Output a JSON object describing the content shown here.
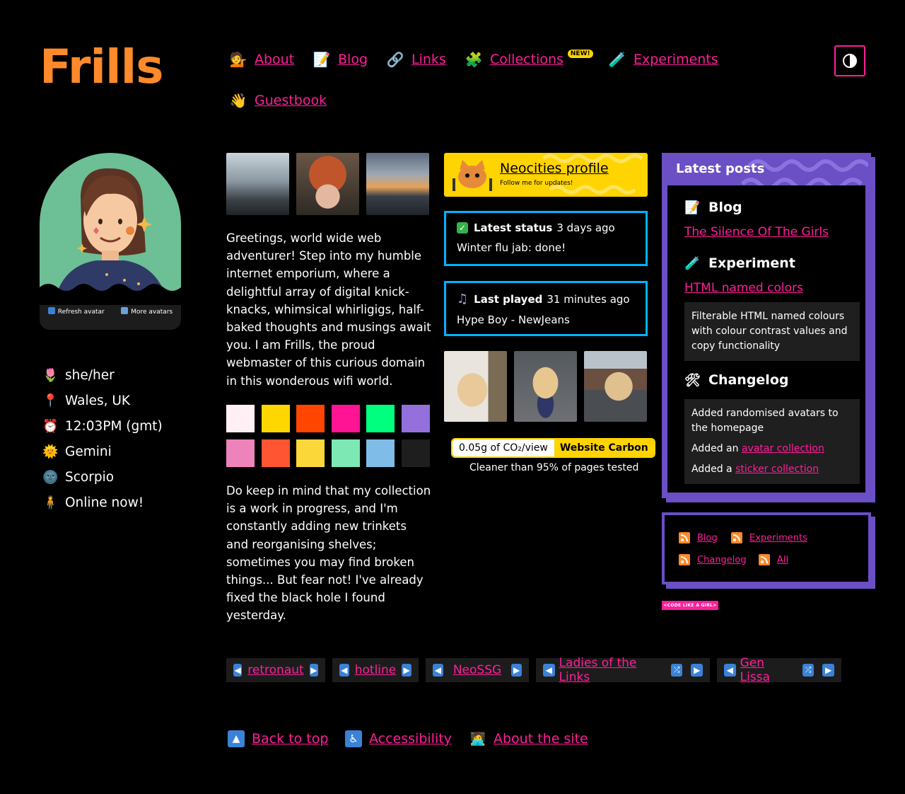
{
  "site": {
    "title": "Frills"
  },
  "nav": [
    {
      "label": "About",
      "icon": "person-tipping-hand-icon"
    },
    {
      "label": "Blog",
      "icon": "memo-icon"
    },
    {
      "label": "Links",
      "icon": "link-icon"
    },
    {
      "label": "Collections",
      "icon": "puzzle-icon",
      "badge": "NEW!"
    },
    {
      "label": "Experiments",
      "icon": "test-tube-icon"
    },
    {
      "label": "Guestbook",
      "icon": "waving-hand-icon"
    }
  ],
  "avatar": {
    "refresh_label": "Refresh avatar",
    "more_label": "More avatars"
  },
  "profile": [
    {
      "icon": "tulip-icon",
      "text": "she/her"
    },
    {
      "icon": "pin-icon",
      "text": "Wales, UK"
    },
    {
      "icon": "alarm-clock-icon",
      "text": "12:03PM (gmt)"
    },
    {
      "icon": "gemini-sun-icon",
      "text": "Gemini"
    },
    {
      "icon": "scorpio-moon-icon",
      "text": "Scorpio"
    },
    {
      "icon": "person-standing-icon",
      "text": "Online now!"
    }
  ],
  "intro": "Greetings, world wide web adventurer! Step into my humble internet emporium, where a delightful array of digital knick-knacks, whimsical whirligigs, half-baked thoughts and musings await you. I am Frills, the proud webmaster of this curious domain in this wonderous wifi world.",
  "swatches": [
    "#fff0f5",
    "#ffd700",
    "#ff4500",
    "#ff1493",
    "#00ff7f",
    "#9370db",
    "#ee82ba",
    "#ff5533",
    "#fcd73a",
    "#7ee8b5",
    "#7fbde8",
    "#1e1e1e"
  ],
  "intro2": "Do keep in mind that my collection is a work in progress, and I'm constantly adding new trinkets and reorganising shelves; sometimes you may find broken things... But fear not! I've already fixed the black hole I found yesterday.",
  "neocities": {
    "title": "Neocities profile",
    "subtitle": "Follow me for updates!"
  },
  "status": {
    "label": "Latest status",
    "time": "3 days ago",
    "text": "Winter flu jab: done!"
  },
  "played": {
    "label": "Last played",
    "time": "31 minutes ago",
    "text": "Hype Boy - NewJeans"
  },
  "carbon": {
    "value": "0.05g of CO₂/view",
    "brand": "Website Carbon",
    "caption": "Cleaner than 95% of pages tested"
  },
  "posts": {
    "title": "Latest posts",
    "blog": {
      "heading": "Blog",
      "link": "The Silence Of The Girls"
    },
    "experiment": {
      "heading": "Experiment",
      "link": "HTML named colors",
      "desc": "Filterable HTML named colours with colour contrast values and copy functionality"
    },
    "changelog": {
      "heading": "Changelog",
      "item1": "Added randomised avatars to the homepage",
      "item2_prefix": "Added an",
      "item2_link": "avatar collection",
      "item3_prefix": "Added a",
      "item3_link": "sticker collection"
    }
  },
  "feeds": [
    "Blog",
    "Experiments",
    "Changelog",
    "All"
  ],
  "codegirl": "<CODE LIKE A GIRL>",
  "webrings": [
    {
      "name": "retronaut"
    },
    {
      "name": "hotline"
    },
    {
      "name": "NeoSSG"
    },
    {
      "name": "Ladies of the Links"
    },
    {
      "name": "Gen Lissa"
    }
  ],
  "footer": [
    {
      "label": "Back to top",
      "icon": "up-arrow-icon"
    },
    {
      "label": "Accessibility",
      "icon": "wheelchair-icon"
    },
    {
      "label": "About the site",
      "icon": "technologist-icon"
    }
  ],
  "colors": {
    "accent": "#ff1e9a",
    "logo": "#ff8a2b",
    "purple": "#6a4fc5",
    "blue": "#00b2ff",
    "yellow": "#ffd400"
  }
}
